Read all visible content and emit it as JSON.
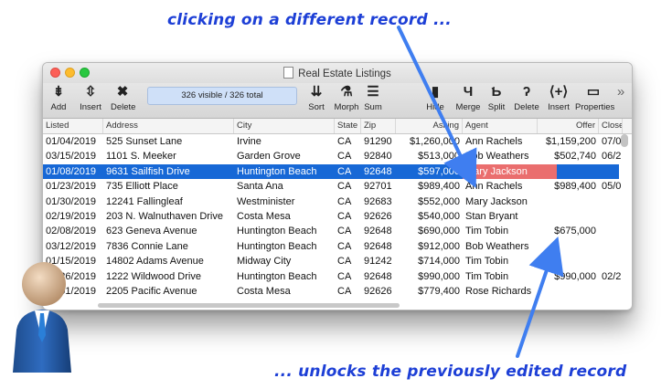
{
  "annotations": {
    "top": "clicking on a different record ...",
    "bottom": "... unlocks the previously edited record"
  },
  "window": {
    "title": "Real Estate Listings"
  },
  "toolbar": {
    "status": "326 visible / 326 total",
    "buttons": [
      {
        "label": "Add",
        "icon": "add-icon",
        "glyph": "⇟"
      },
      {
        "label": "Insert",
        "icon": "insert-icon",
        "glyph": "⇳"
      },
      {
        "label": "Delete",
        "icon": "delete-icon",
        "glyph": "✖"
      },
      {
        "label": "Sort",
        "icon": "sort-icon",
        "glyph": "⇊"
      },
      {
        "label": "Morph",
        "icon": "morph-icon",
        "glyph": "⚗"
      },
      {
        "label": "Sum",
        "icon": "sum-icon",
        "glyph": "☰"
      },
      {
        "label": "Hide",
        "icon": "hide-icon",
        "glyph": "▮"
      },
      {
        "label": "Merge",
        "icon": "merge-icon",
        "glyph": "Ч"
      },
      {
        "label": "Split",
        "icon": "split-icon",
        "glyph": "Ƅ"
      },
      {
        "label": "Delete",
        "icon": "delete-column-icon",
        "glyph": "ʔ"
      },
      {
        "label": "Insert",
        "icon": "insert-column-icon",
        "glyph": "⟨+⟩"
      },
      {
        "label": "Properties",
        "icon": "properties-icon",
        "glyph": "▭"
      }
    ],
    "overflow": "»"
  },
  "columns": [
    "Listed",
    "Address",
    "City",
    "State",
    "Zip",
    "Asking",
    "Agent",
    "Offer",
    "Close"
  ],
  "rows": [
    [
      "01/04/2019",
      "525 Sunset Lane",
      "Irvine",
      "CA",
      "91290",
      "$1,260,000",
      "Ann Rachels",
      "$1,159,200",
      "07/0"
    ],
    [
      "03/15/2019",
      "1101 S. Meeker",
      "Garden Grove",
      "CA",
      "92840",
      "$513,000",
      "Bob Weathers",
      "$502,740",
      "06/2"
    ],
    [
      "01/08/2019",
      "9631 Sailfish Drive",
      "Huntington Beach",
      "CA",
      "92648",
      "$597,000",
      "Mary Jackson",
      "",
      ""
    ],
    [
      "01/23/2019",
      "735 Elliott Place",
      "Santa Ana",
      "CA",
      "92701",
      "$989,400",
      "Ann Rachels",
      "$989,400",
      "05/0"
    ],
    [
      "01/30/2019",
      "12241 Fallingleaf",
      "Westminister",
      "CA",
      "92683",
      "$552,000",
      "Mary Jackson",
      "",
      ""
    ],
    [
      "02/19/2019",
      "203 N. Walnuthaven Drive",
      "Costa Mesa",
      "CA",
      "92626",
      "$540,000",
      "Stan Bryant",
      "",
      ""
    ],
    [
      "02/08/2019",
      "623 Geneva Avenue",
      "Huntington Beach",
      "CA",
      "92648",
      "$690,000",
      "Tim Tobin",
      "$675,000",
      ""
    ],
    [
      "03/12/2019",
      "7836 Connie Lane",
      "Huntington Beach",
      "CA",
      "92648",
      "$912,000",
      "Bob Weathers",
      "",
      ""
    ],
    [
      "01/15/2019",
      "14802 Adams Avenue",
      "Midway City",
      "CA",
      "91242",
      "$714,000",
      "Tim Tobin",
      "",
      ""
    ],
    [
      "02/26/2019",
      "1222 Wildwood Drive",
      "Huntington Beach",
      "CA",
      "92648",
      "$990,000",
      "Tim Tobin",
      "$990,000",
      "02/2"
    ],
    [
      "03/01/2019",
      "2205 Pacific Avenue",
      "Costa Mesa",
      "CA",
      "92626",
      "$779,400",
      "Rose Richards",
      "",
      ""
    ]
  ],
  "selected_row": 2,
  "edited_cell": {
    "row": 2,
    "col": 6
  },
  "colors": {
    "annotation": "#1d3fd6",
    "selection": "#1768d6",
    "edited": "#ea6e6e",
    "arrow": "#3f7ef0"
  }
}
